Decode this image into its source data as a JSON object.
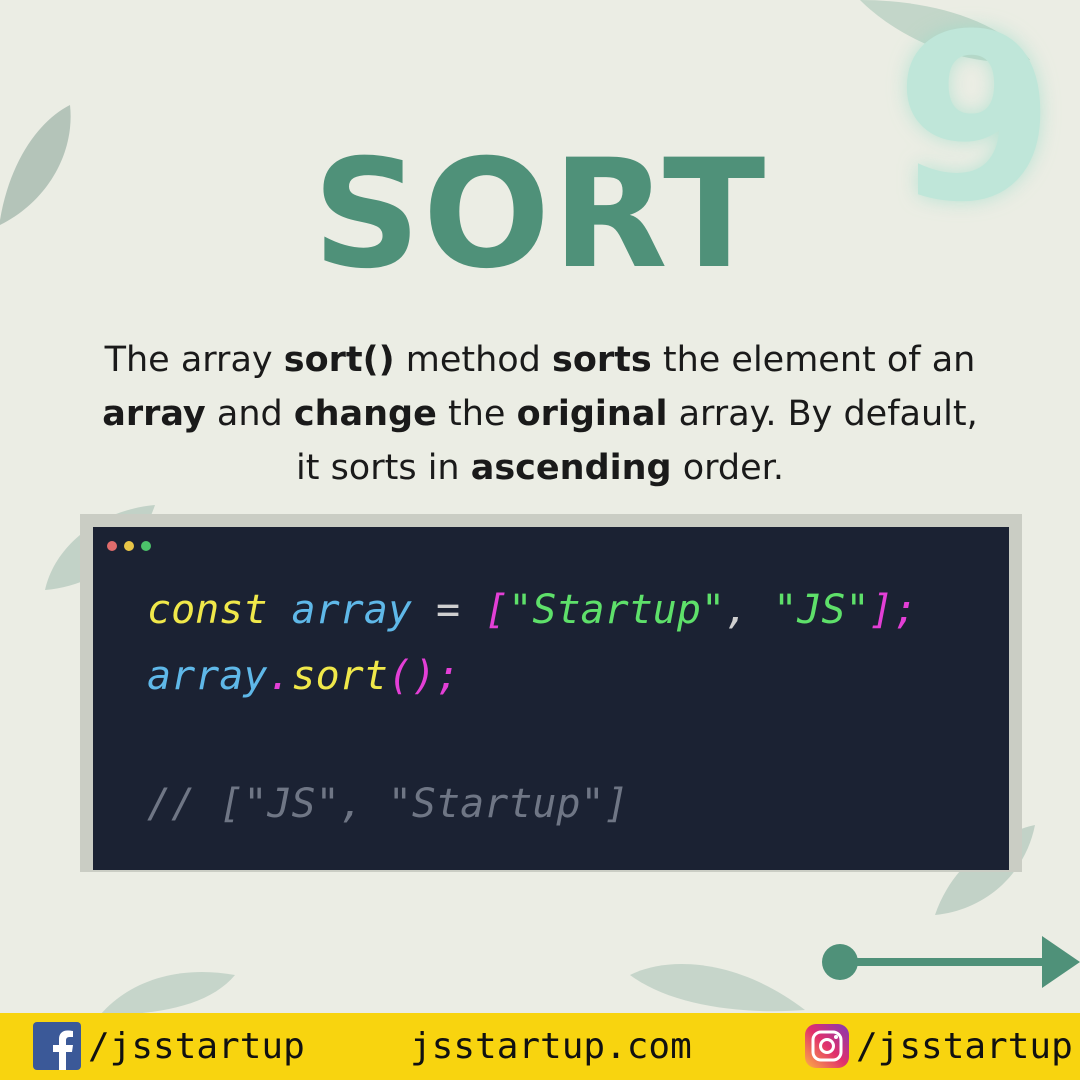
{
  "post_number": "9",
  "title": "SORT",
  "description": [
    {
      "text": "The array ",
      "bold": false
    },
    {
      "text": "sort()",
      "bold": true
    },
    {
      "text": " method ",
      "bold": false
    },
    {
      "text": "sorts",
      "bold": true
    },
    {
      "text": " the element of an ",
      "bold": false
    },
    {
      "text": "array",
      "bold": true
    },
    {
      "text": " and ",
      "bold": false
    },
    {
      "text": "change",
      "bold": true
    },
    {
      "text": " the ",
      "bold": false
    },
    {
      "text": "original",
      "bold": true
    },
    {
      "text": " array. By default, it sorts in ",
      "bold": false
    },
    {
      "text": "ascending",
      "bold": true
    },
    {
      "text": " order.",
      "bold": false
    }
  ],
  "code": {
    "lines": [
      [
        {
          "text": "const",
          "color": "#f0e84a"
        },
        {
          "text": " ",
          "color": "#ffffff"
        },
        {
          "text": "array",
          "color": "#5fb8e8"
        },
        {
          "text": " = ",
          "color": "#cfcfcf"
        },
        {
          "text": "[",
          "color": "#e33fd6"
        },
        {
          "text": "\"Startup\"",
          "color": "#5ee06a"
        },
        {
          "text": ", ",
          "color": "#cfcfcf"
        },
        {
          "text": "\"JS\"",
          "color": "#5ee06a"
        },
        {
          "text": "]",
          "color": "#e33fd6"
        },
        {
          "text": ";",
          "color": "#e33fd6"
        }
      ],
      [
        {
          "text": "array",
          "color": "#5fb8e8"
        },
        {
          "text": ".",
          "color": "#e33fd6"
        },
        {
          "text": "sort",
          "color": "#f0e84a"
        },
        {
          "text": "()",
          "color": "#e33fd6"
        },
        {
          "text": ";",
          "color": "#e33fd6"
        }
      ],
      [],
      [
        {
          "text": "// [\"JS\", \"Startup\"]",
          "color": "#6f7685"
        }
      ]
    ],
    "dot_colors": [
      "#e06c6c",
      "#e8c547",
      "#4cc26a"
    ]
  },
  "next_arrow_icon": "arrow-right-icon",
  "footer": {
    "facebook_handle": "/jsstartup",
    "website": "jsstartup.com",
    "instagram_handle": "/jsstartup",
    "facebook_icon": "facebook-icon",
    "instagram_icon": "instagram-icon"
  },
  "colors": {
    "background": "#ebede4",
    "accent": "#4f9179",
    "code_bg": "#1b2233",
    "footer_bg": "#f8d40f"
  }
}
